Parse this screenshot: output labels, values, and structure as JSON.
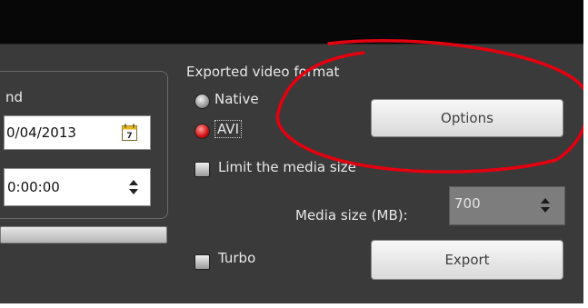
{
  "date_group": {
    "label": "nd",
    "date_value": "0/04/2013",
    "time_value": "0:00:00"
  },
  "export_panel": {
    "title": "Exported video format",
    "format_options": [
      {
        "label": "Native",
        "selected": false
      },
      {
        "label": "AVI",
        "selected": true
      }
    ],
    "options_button": "Options",
    "limit_media_size": {
      "label": "Limit the media size",
      "checked": false
    },
    "media_size": {
      "label": "Media size (MB):",
      "value": "700",
      "enabled": false
    },
    "turbo": {
      "label": "Turbo",
      "checked": false
    },
    "export_button": "Export"
  },
  "colors": {
    "annotation": "#e5000f",
    "background": "#3a3a3a",
    "radio_selected": "#d01010"
  },
  "icons": [
    "calendar-icon",
    "spinner-arrows-icon"
  ]
}
